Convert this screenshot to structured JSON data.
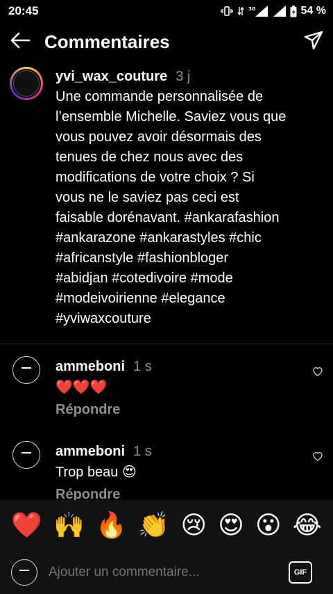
{
  "status_bar": {
    "time": "20:45",
    "battery": "54 %",
    "network": "3G"
  },
  "header": {
    "title": "Commentaires"
  },
  "caption": {
    "username": "yvi_wax_couture",
    "time": "3 j",
    "text": "Une commande personnalisée de\nl’ensemble Michelle. Saviez vous que\nvous pouvez avoir désormais des\ntenues de chez nous avec des\nmodifications de votre choix ?  Si\nvous ne le saviez pas ceci est\nfaisable dorénavant. #ankarafashion\n#ankarazone #ankarastyles #chic\n#africanstyle #fashionbloger\n#abidjan #cotedivoire #mode\n#modeivoirienne #elegance\n#yviwaxcouture"
  },
  "comments": [
    {
      "username": "ammeboni",
      "time": "1 s",
      "text": "❤️❤️❤️",
      "reply_label": "Répondre"
    },
    {
      "username": "ammeboni",
      "time": "1 s",
      "text": "Trop beau 😍",
      "reply_label": "Répondre"
    }
  ],
  "emoji_bar": {
    "emojis": [
      "❤️",
      "🙌",
      "🔥",
      "👏",
      "😢",
      "😍",
      "😮",
      "😂"
    ]
  },
  "composer": {
    "placeholder": "Ajouter un commentaire...",
    "gif_label": "GIF"
  }
}
